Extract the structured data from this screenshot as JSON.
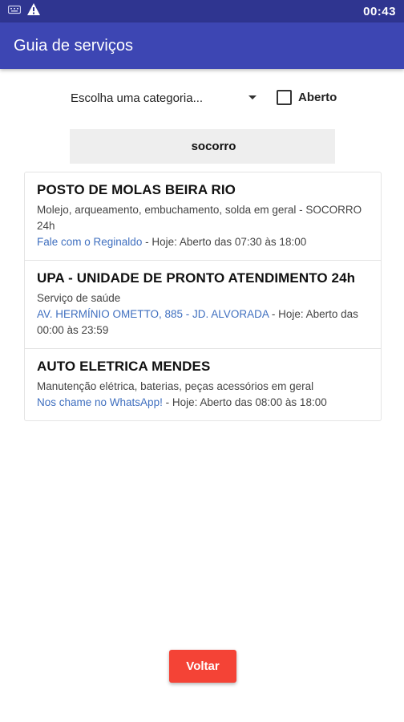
{
  "status_bar": {
    "time": "00:43",
    "icons": [
      "keyboard-icon",
      "warning-icon"
    ]
  },
  "app_bar": {
    "title": "Guia de serviços",
    "color": "#3d46b3"
  },
  "filters": {
    "category_selected": "Escolha uma categoria...",
    "open_checkbox_label": "Aberto",
    "open_checked": false
  },
  "search": {
    "value": "socorro"
  },
  "results": [
    {
      "title": "POSTO DE MOLAS BEIRA RIO",
      "description": "Molejo, arqueamento, embuchamento, solda em geral - SOCORRO 24h",
      "link": "Fale com o Reginaldo",
      "status": " - Hoje: Aberto das 07:30 às 18:00"
    },
    {
      "title": "UPA - UNIDADE DE PRONTO ATENDIMENTO 24h",
      "description": "Serviço de saúde",
      "link": "AV. HERMÍNIO OMETTO, 885 - JD. ALVORADA",
      "status": " - Hoje: Aberto das 00:00 às 23:59"
    },
    {
      "title": "AUTO ELETRICA MENDES",
      "description": "Manutenção elétrica, baterias, peças acessórios em geral",
      "link": "Nos chame no WhatsApp!",
      "status": " - Hoje: Aberto das 08:00 às 18:00"
    }
  ],
  "footer": {
    "back_label": "Voltar",
    "back_color": "#f44336"
  },
  "colors": {
    "status_bar": "#2f3590",
    "link": "#3f6fbf"
  }
}
